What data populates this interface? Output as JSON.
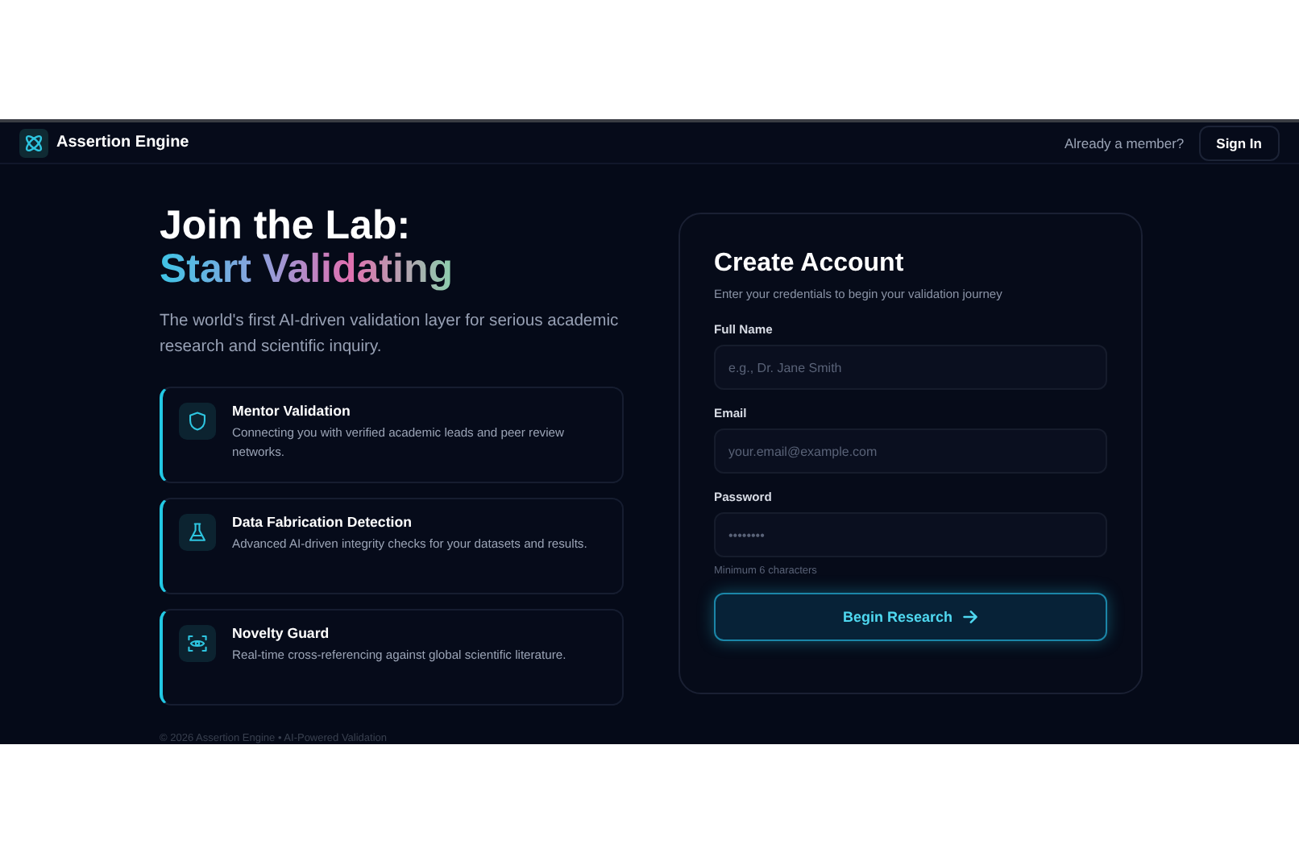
{
  "header": {
    "brand": "Assertion Engine",
    "prompt": "Already a member?",
    "sign_in": "Sign In"
  },
  "hero": {
    "title_line1": "Join the Lab:",
    "title_line2": "Start Validating",
    "subtitle": "The world's first AI-driven validation layer for serious academic research and scientific inquiry."
  },
  "features": [
    {
      "kind": "shield",
      "title": "Mentor Validation",
      "description": "Connecting you with verified academic leads and peer review networks."
    },
    {
      "kind": "flask",
      "title": "Data Fabrication Detection",
      "description": "Advanced AI-driven integrity checks for your datasets and results."
    },
    {
      "kind": "eye",
      "title": "Novelty Guard",
      "description": "Real-time cross-referencing against global scientific literature."
    }
  ],
  "form": {
    "title": "Create Account",
    "subtitle": "Enter your credentials to begin your validation journey",
    "fields": [
      {
        "label": "Full Name",
        "placeholder": "e.g., Dr. Jane Smith"
      },
      {
        "label": "Email",
        "placeholder": "your.email@example.com"
      },
      {
        "label": "Password",
        "placeholder": "••••••••",
        "hint": "Minimum 6 characters"
      }
    ],
    "submit": "Begin Research"
  },
  "footer": "© 2026 Assertion Engine • AI-Powered Validation"
}
